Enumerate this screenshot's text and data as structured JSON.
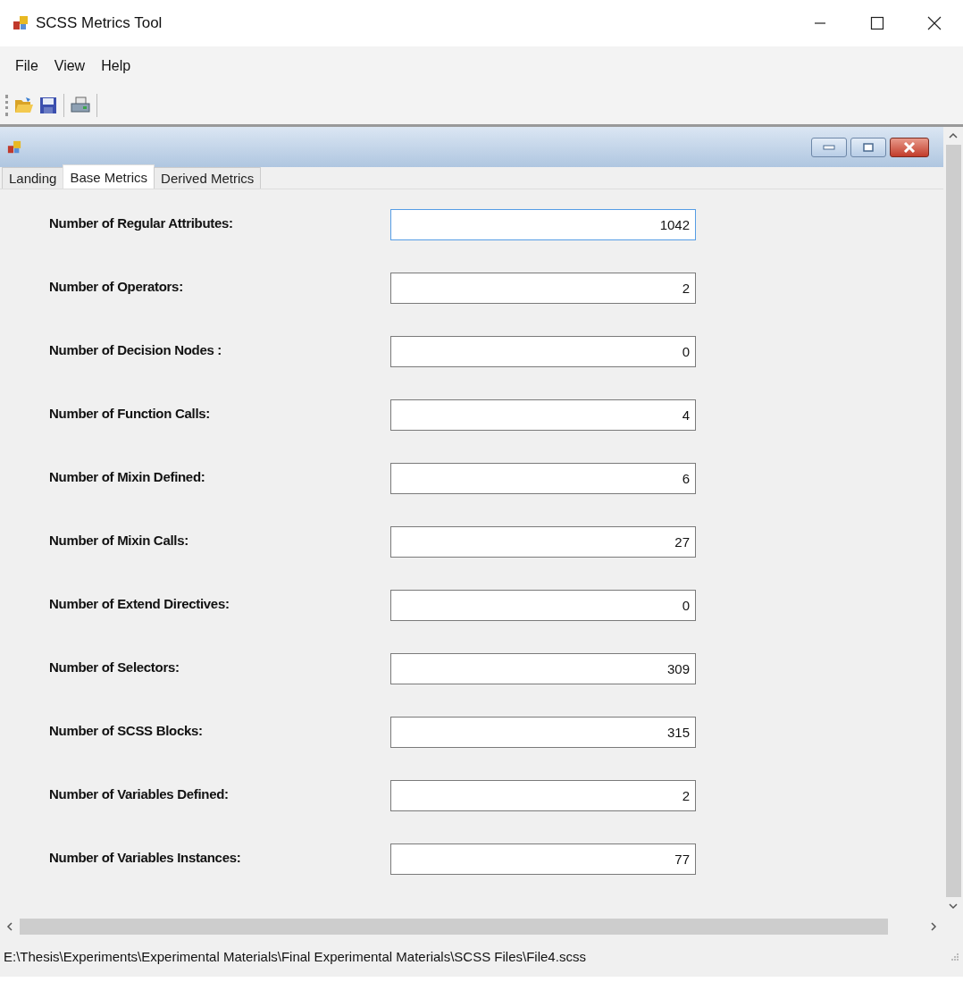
{
  "window": {
    "title": "SCSS Metrics Tool"
  },
  "menu": [
    "File",
    "View",
    "Help"
  ],
  "tabs": [
    {
      "label": "Landing",
      "selected": false
    },
    {
      "label": "Base Metrics",
      "selected": true
    },
    {
      "label": "Derived Metrics",
      "selected": false
    }
  ],
  "metrics": [
    {
      "label": "Number of Regular Attributes:",
      "value": "1042",
      "focused": true
    },
    {
      "label": "Number of Operators:",
      "value": "2",
      "focused": false
    },
    {
      "label": "Number of Decision Nodes :",
      "value": "0",
      "focused": false
    },
    {
      "label": "Number of Function Calls:",
      "value": "4",
      "focused": false
    },
    {
      "label": "Number of Mixin Defined:",
      "value": "6",
      "focused": false
    },
    {
      "label": "Number of Mixin Calls:",
      "value": "27",
      "focused": false
    },
    {
      "label": "Number of Extend Directives:",
      "value": "0",
      "focused": false
    },
    {
      "label": "Number of Selectors:",
      "value": "309",
      "focused": false
    },
    {
      "label": "Number of SCSS Blocks:",
      "value": "315",
      "focused": false
    },
    {
      "label": "Number of Variables Defined:",
      "value": "2",
      "focused": false
    },
    {
      "label": "Number of Variables Instances:",
      "value": "77",
      "focused": false
    }
  ],
  "status_bar": "E:\\Thesis\\Experiments\\Experimental Materials\\Final Experimental Materials\\SCSS Files\\File4.scss"
}
